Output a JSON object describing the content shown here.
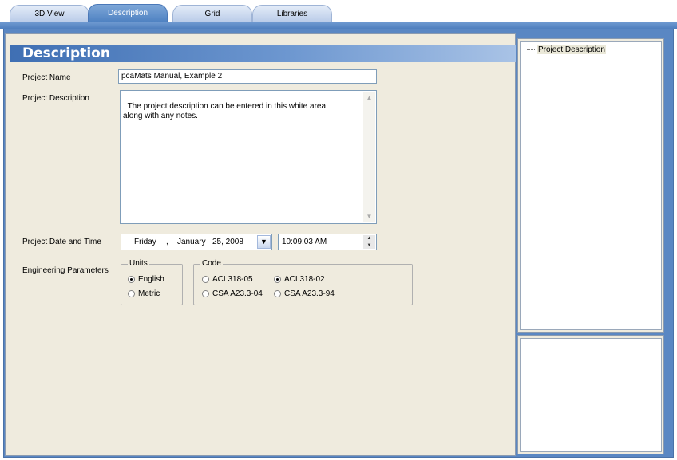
{
  "tabs": [
    {
      "label": "3D View",
      "active": false
    },
    {
      "label": "Description",
      "active": true
    },
    {
      "label": "Grid",
      "active": false
    },
    {
      "label": "Libraries",
      "active": false
    }
  ],
  "section_title": "Description",
  "project_name": {
    "label": "Project Name",
    "value": "pcaMats Manual, Example 2"
  },
  "project_description": {
    "label": "Project Description",
    "value": "The project description can be entered in this white area\nalong with any notes."
  },
  "date_time": {
    "label": "Project Date and Time",
    "weekday": "Friday",
    "sep": ",",
    "month": "January",
    "day_year": "25, 2008",
    "time": "10:09:03 AM"
  },
  "engineering": {
    "label": "Engineering Parameters",
    "units": {
      "legend": "Units",
      "options": [
        "English",
        "Metric"
      ],
      "selected": "English"
    },
    "code": {
      "legend": "Code",
      "options": [
        "ACI 318-05",
        "ACI 318-02",
        "CSA A23.3-04",
        "CSA A23.3-94"
      ],
      "selected": "ACI 318-02"
    }
  },
  "tree": {
    "items": [
      "Project Description"
    ]
  },
  "colors": {
    "accent": "#4f7fbe",
    "panel": "#efebde"
  }
}
